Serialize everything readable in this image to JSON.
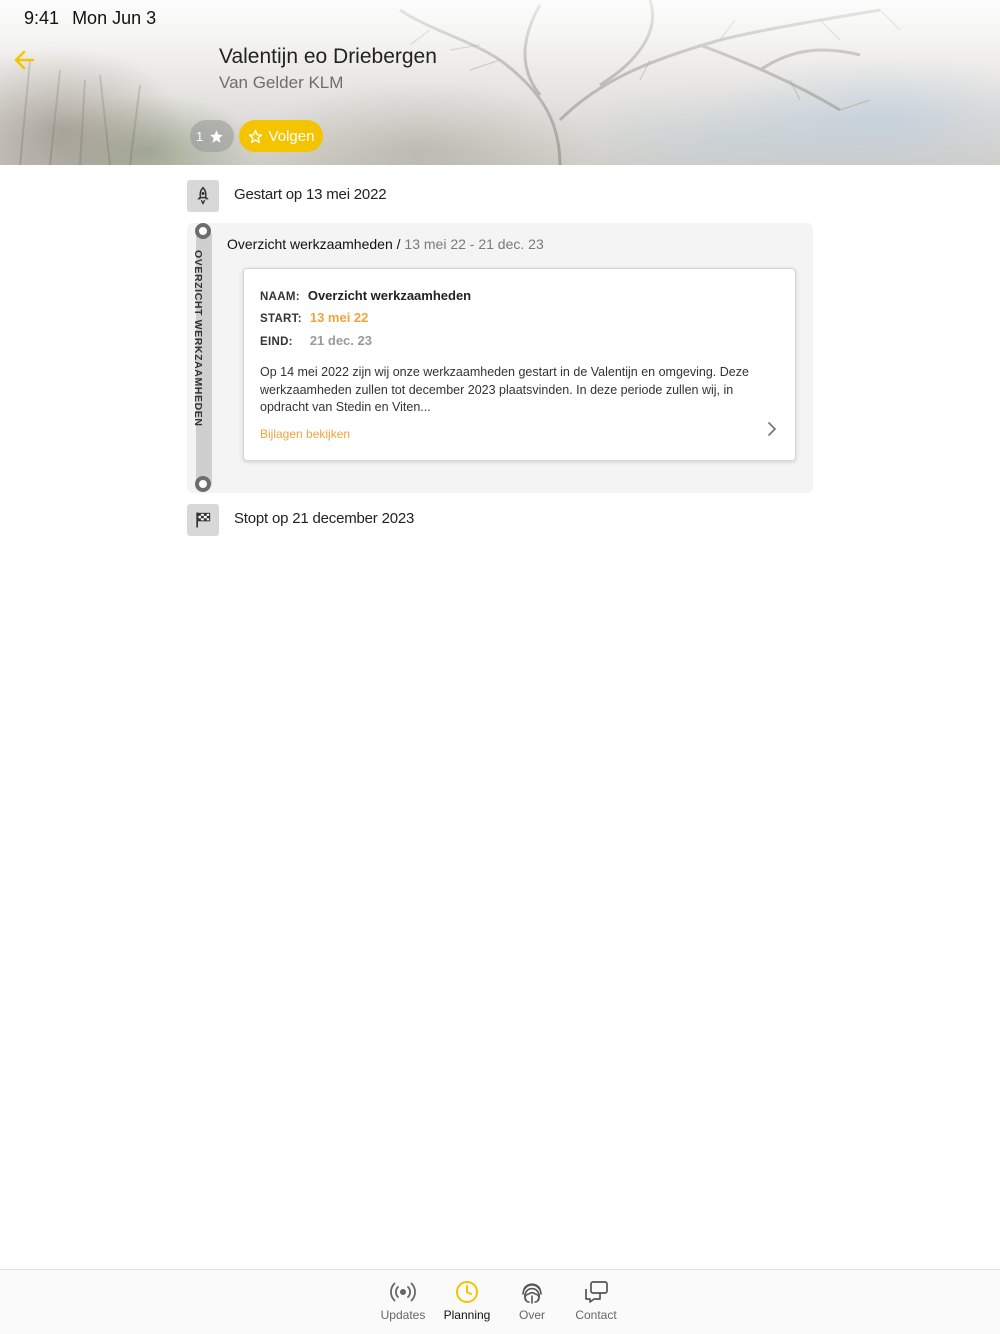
{
  "status_bar": {
    "time": "9:41",
    "date": "Mon Jun 3"
  },
  "header": {
    "title": "Valentijn eo Driebergen",
    "subtitle": "Van Gelder KLM",
    "follower_count": "1",
    "follow_label": "Volgen"
  },
  "timeline": {
    "start_label": "Gestart op 13 mei 2022",
    "end_label": "Stopt op 21 december 2023",
    "phase": {
      "vertical_label": "OVERZICHT WERKZAAMHEDEN",
      "heading_name": "Overzicht werkzaamheden /",
      "heading_dates": "13 mei 22 - 21 dec. 23",
      "card": {
        "name_key": "NAAM:",
        "name_value": "Overzicht werkzaamheden",
        "start_key": "START:",
        "start_value": "13 mei 22",
        "end_key": "EIND:",
        "end_value": "21 dec. 23",
        "description": "Op 14 mei 2022 zijn wij onze werkzaamheden gestart in de Valentijn en omgeving. Deze werkzaamheden zullen tot december 2023 plaatsvinden. In deze periode zullen wij, in opdracht van Stedin en Viten...",
        "attachments_link": "Bijlagen bekijken"
      }
    }
  },
  "tabs": [
    {
      "label": "Updates",
      "icon": "broadcast-icon"
    },
    {
      "label": "Planning",
      "icon": "clock-icon",
      "active": true
    },
    {
      "label": "Over",
      "icon": "fingerprint-icon"
    },
    {
      "label": "Contact",
      "icon": "chat-icon"
    }
  ],
  "colors": {
    "accent": "#f5c400",
    "orange": "#f2a33a"
  }
}
